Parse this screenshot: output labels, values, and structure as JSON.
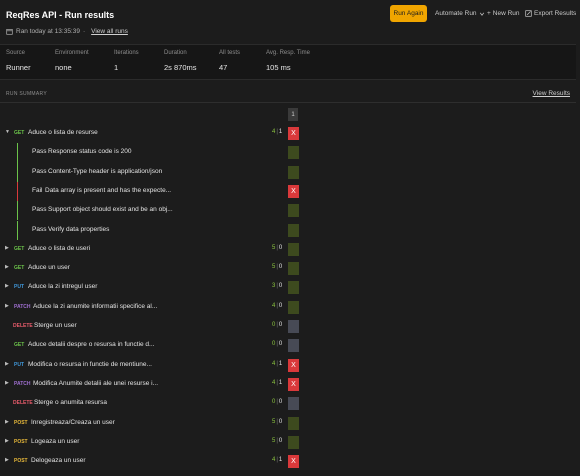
{
  "header": {
    "title": "ReqRes API - Run results",
    "ran_text": "Ran today at 13:35:39",
    "separator": "·",
    "view_all_runs": "View all runs",
    "run_again": "Run Again",
    "automate_run": "Automate Run",
    "new_run": "New Run",
    "export_results": "Export Results"
  },
  "stats": [
    {
      "label": "Source",
      "value": "Runner"
    },
    {
      "label": "Environment",
      "value": "none"
    },
    {
      "label": "Iterations",
      "value": "1"
    },
    {
      "label": "Duration",
      "value": "2s 870ms"
    },
    {
      "label": "All tests",
      "value": "47"
    },
    {
      "label": "Avg. Resp. Time",
      "value": "105 ms"
    }
  ],
  "summary": {
    "label": "RUN SUMMARY",
    "view_results": "View Results",
    "iteration_header": "1"
  },
  "rows": [
    {
      "kind": "request",
      "expanded": true,
      "method": "GET",
      "name": "Aduce o lista de resurse",
      "passed": "4",
      "failed": "1",
      "result": "fail"
    },
    {
      "kind": "assert",
      "status": "Pass",
      "name": "Response status code is 200",
      "result": "pass"
    },
    {
      "kind": "assert",
      "status": "Pass",
      "name": "Content-Type header is application/json",
      "result": "pass"
    },
    {
      "kind": "assert",
      "status": "Fail",
      "name": "Data array is present and has the expecte...",
      "result": "fail"
    },
    {
      "kind": "assert",
      "status": "Pass",
      "name": "Support object should exist and be an obj...",
      "result": "pass"
    },
    {
      "kind": "assert",
      "status": "Pass",
      "name": "Verify data properties",
      "result": "pass"
    },
    {
      "kind": "request",
      "expanded": false,
      "method": "GET",
      "name": "Aduce o lista de useri",
      "passed": "5",
      "failed": "0",
      "result": "pass"
    },
    {
      "kind": "request",
      "expanded": false,
      "method": "GET",
      "name": "Aduce un user",
      "passed": "5",
      "failed": "0",
      "result": "pass"
    },
    {
      "kind": "request",
      "expanded": false,
      "method": "PUT",
      "name": "Aduce la zi intregul user",
      "passed": "3",
      "failed": "0",
      "result": "pass"
    },
    {
      "kind": "request",
      "expanded": false,
      "method": "PATCH",
      "name": "Aduce la zi anumite informatii specifice al...",
      "passed": "4",
      "failed": "0",
      "result": "pass"
    },
    {
      "kind": "request",
      "expanded": null,
      "method": "DELETE",
      "name": "Sterge un user",
      "passed": "0",
      "failed": "0",
      "result": "skip"
    },
    {
      "kind": "request",
      "expanded": null,
      "method": "GET",
      "name": "Aduce detalii despre o resursa in functie d...",
      "passed": "0",
      "failed": "0",
      "result": "skip"
    },
    {
      "kind": "request",
      "expanded": false,
      "method": "PUT",
      "name": "Modifica o resursa in functie de mentiune...",
      "passed": "4",
      "failed": "1",
      "result": "fail"
    },
    {
      "kind": "request",
      "expanded": false,
      "method": "PATCH",
      "name": "Modifica Anumite detalii ale unei resurse i...",
      "passed": "4",
      "failed": "1",
      "result": "fail"
    },
    {
      "kind": "request",
      "expanded": null,
      "method": "DELETE",
      "name": "Sterge o anumita resursa",
      "passed": "0",
      "failed": "0",
      "result": "skip"
    },
    {
      "kind": "request",
      "expanded": false,
      "method": "POST",
      "name": "Inregistreaza/Creaza un user",
      "passed": "5",
      "failed": "0",
      "result": "pass"
    },
    {
      "kind": "request",
      "expanded": false,
      "method": "POST",
      "name": "Logeaza un user",
      "passed": "5",
      "failed": "0",
      "result": "pass"
    },
    {
      "kind": "request",
      "expanded": false,
      "method": "POST",
      "name": "Delogeaza un user",
      "passed": "4",
      "failed": "1",
      "result": "fail"
    }
  ],
  "symbols": {
    "fail_mark": "X",
    "count_sep": "|",
    "caret_open": "▼",
    "caret_closed": "▶"
  },
  "colors": {
    "accent": "#f0a500",
    "pass": "#8cc63f",
    "fail": "#d9393b"
  }
}
